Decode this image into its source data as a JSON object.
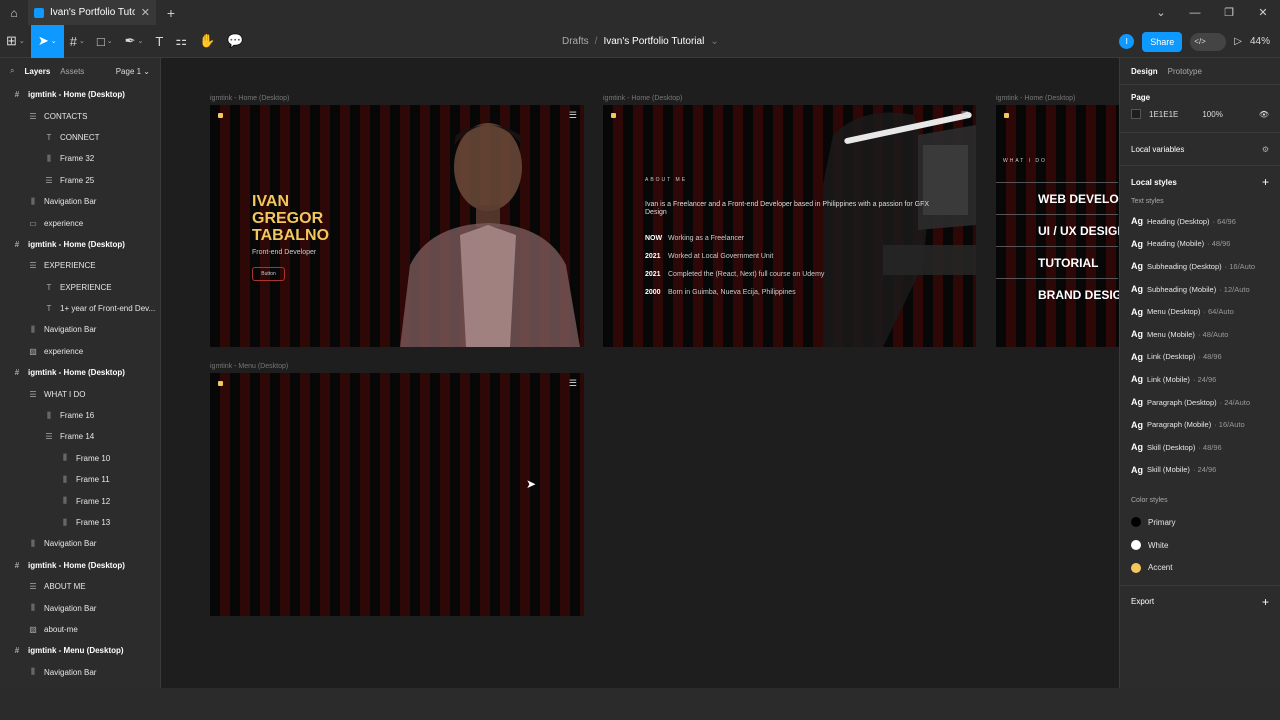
{
  "tab": {
    "title": "Ivan's Portfolio Tutorial",
    "close": "✕",
    "new": "+"
  },
  "window": {
    "minimize": "⌄",
    "min2": "—",
    "max": "❐",
    "close": "✕"
  },
  "toolbar": {
    "breadcrumb_drafts": "Drafts",
    "breadcrumb_sep": "/",
    "file_name": "Ivan's Portfolio Tutorial",
    "chevron": "⌄",
    "avatar": "I",
    "share_label": "Share",
    "devmode": "</>",
    "play": "▷",
    "zoom": "44%"
  },
  "layers_panel": {
    "tab_layers": "Layers",
    "tab_assets": "Assets",
    "page": "Page 1 ⌄",
    "items": [
      {
        "label": "igmtink - Home (Desktop)",
        "indent": 0,
        "icon": "#"
      },
      {
        "label": "CONTACTS",
        "indent": 1,
        "icon": "☰"
      },
      {
        "label": "CONNECT",
        "indent": 2,
        "icon": "T"
      },
      {
        "label": "Frame 32",
        "indent": 2,
        "icon": "⫼"
      },
      {
        "label": "Frame 25",
        "indent": 2,
        "icon": "☰"
      },
      {
        "label": "Navigation Bar",
        "indent": 1,
        "icon": "⫼"
      },
      {
        "label": "experience",
        "indent": 1,
        "icon": "▭"
      },
      {
        "label": "igmtink - Home (Desktop)",
        "indent": 0,
        "icon": "#"
      },
      {
        "label": "EXPERIENCE",
        "indent": 1,
        "icon": "☰"
      },
      {
        "label": "EXPERIENCE",
        "indent": 2,
        "icon": "T"
      },
      {
        "label": "1+ year of Front-end Dev...",
        "indent": 2,
        "icon": "T"
      },
      {
        "label": "Navigation Bar",
        "indent": 1,
        "icon": "⫼"
      },
      {
        "label": "experience",
        "indent": 1,
        "icon": "▨"
      },
      {
        "label": "igmtink - Home (Desktop)",
        "indent": 0,
        "icon": "#"
      },
      {
        "label": "WHAT I DO",
        "indent": 1,
        "icon": "☰"
      },
      {
        "label": "Frame 16",
        "indent": 2,
        "icon": "⫼"
      },
      {
        "label": "Frame 14",
        "indent": 2,
        "icon": "☰"
      },
      {
        "label": "Frame 10",
        "indent": 3,
        "icon": "⫼"
      },
      {
        "label": "Frame 11",
        "indent": 3,
        "icon": "⫼"
      },
      {
        "label": "Frame 12",
        "indent": 3,
        "icon": "⫼"
      },
      {
        "label": "Frame 13",
        "indent": 3,
        "icon": "⫼"
      },
      {
        "label": "Navigation Bar",
        "indent": 1,
        "icon": "⫼"
      },
      {
        "label": "igmtink - Home (Desktop)",
        "indent": 0,
        "icon": "#"
      },
      {
        "label": "ABOUT ME",
        "indent": 1,
        "icon": "☰"
      },
      {
        "label": "Navigation Bar",
        "indent": 1,
        "icon": "⫼"
      },
      {
        "label": "about-me",
        "indent": 1,
        "icon": "▨"
      },
      {
        "label": "igmtink - Menu (Desktop)",
        "indent": 0,
        "icon": "#"
      },
      {
        "label": "Navigation Bar",
        "indent": 1,
        "icon": "⫼"
      }
    ]
  },
  "canvas": {
    "frame1_label": "igmtink - Home (Desktop)",
    "frame2_label": "igmtink - Home (Desktop)",
    "frame3_label": "igmtink - Home (Desktop)",
    "frame4_label": "igmtink - Menu (Desktop)",
    "menu_glyph": "☰",
    "hero": {
      "name": "IVAN GREGOR TABALNO",
      "role": "Front-end Developer",
      "button": "Button"
    },
    "about": {
      "title": "ABOUT ME",
      "desc": "Ivan is a Freelancer and a Front-end Developer based in Philippines with a passion for GFX Design",
      "timeline": [
        {
          "year": "NOW",
          "text": "Working as a Freelancer"
        },
        {
          "year": "2021",
          "text": "Worked at Local Government Unit"
        },
        {
          "year": "2021",
          "text": "Completed the (React, Next) full course on Udemy"
        },
        {
          "year": "2000",
          "text": "Born in Guimba, Nueva Ecija, Philippines"
        }
      ]
    },
    "whatido": {
      "title": "WHAT I DO",
      "skills": [
        "WEB DEVELOPI",
        "UI / UX DESIGN",
        "TUTORIAL",
        "BRAND DESIGN"
      ]
    }
  },
  "design_panel": {
    "tab_design": "Design",
    "tab_prototype": "Prototype",
    "page_section": "Page",
    "page_color": "1E1E1E",
    "page_opacity": "100%",
    "local_variables": "Local variables",
    "local_styles": "Local styles",
    "text_styles_label": "Text styles",
    "ag": "Ag",
    "text_styles": [
      {
        "name": "Heading (Desktop)",
        "meta": "· 64/96"
      },
      {
        "name": "Heading (Mobile)",
        "meta": "· 48/96"
      },
      {
        "name": "Subheading (Desktop)",
        "meta": "· 16/Auto"
      },
      {
        "name": "Subheading (Mobile)",
        "meta": "· 12/Auto"
      },
      {
        "name": "Menu (Desktop)",
        "meta": "· 64/Auto"
      },
      {
        "name": "Menu (Mobile)",
        "meta": "· 48/Auto"
      },
      {
        "name": "Link (Desktop)",
        "meta": "· 48/96"
      },
      {
        "name": "Link (Mobile)",
        "meta": "· 24/96"
      },
      {
        "name": "Paragraph (Desktop)",
        "meta": "· 24/Auto"
      },
      {
        "name": "Paragraph (Mobile)",
        "meta": "· 16/Auto"
      },
      {
        "name": "Skill (Desktop)",
        "meta": "· 48/96"
      },
      {
        "name": "Skill (Mobile)",
        "meta": "· 24/96"
      }
    ],
    "color_styles_label": "Color styles",
    "color_styles": [
      {
        "name": "Primary",
        "color": "#000000"
      },
      {
        "name": "White",
        "color": "#ffffff"
      },
      {
        "name": "Accent",
        "color": "#f2c75c"
      }
    ],
    "export": "Export",
    "plus": "+"
  },
  "colors": {
    "accent": "#0d99ff",
    "brand_gold": "#f2c75c",
    "stripe_red": "#2e0707"
  }
}
